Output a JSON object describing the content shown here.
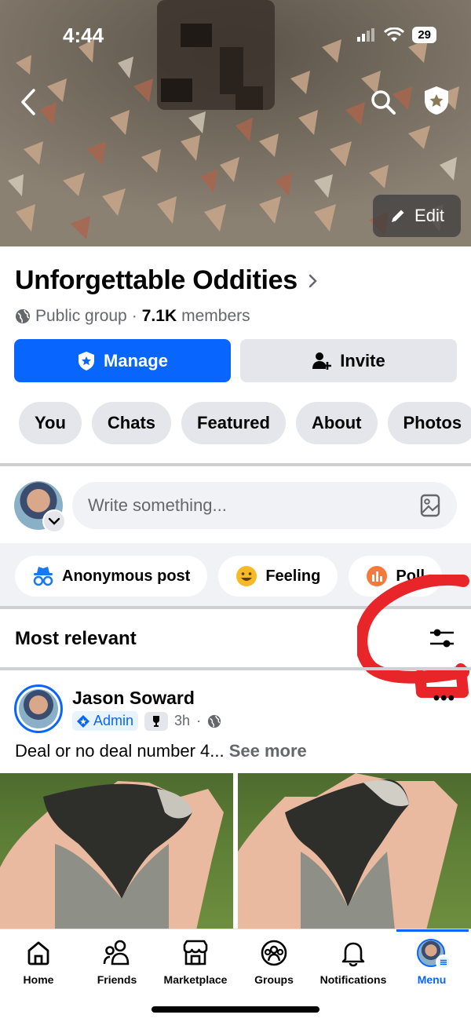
{
  "status": {
    "time": "4:44",
    "battery": "29"
  },
  "cover": {
    "edit_label": "Edit"
  },
  "group": {
    "name": "Unforgettable Oddities",
    "privacy": "Public group",
    "separator": "·",
    "member_count": "7.1K",
    "members_label": "members"
  },
  "actions": {
    "manage": "Manage",
    "invite": "Invite"
  },
  "tabs": [
    "You",
    "Chats",
    "Featured",
    "About",
    "Photos"
  ],
  "composer": {
    "placeholder": "Write something..."
  },
  "quick_actions": [
    "Anonymous post",
    "Feeling",
    "Poll"
  ],
  "feed": {
    "sort_label": "Most relevant"
  },
  "post": {
    "author": "Jason Soward",
    "badge": "Admin",
    "time": "3h",
    "separator": "·",
    "text": "Deal or no deal number 4...",
    "see_more": "See more",
    "more": "•••"
  },
  "bottom_nav": [
    {
      "label": "Home",
      "icon": "home-icon"
    },
    {
      "label": "Friends",
      "icon": "friends-icon"
    },
    {
      "label": "Marketplace",
      "icon": "marketplace-icon"
    },
    {
      "label": "Groups",
      "icon": "groups-icon"
    },
    {
      "label": "Notifications",
      "icon": "bell-icon"
    },
    {
      "label": "Menu",
      "icon": "avatar-menu-icon"
    }
  ],
  "colors": {
    "accent": "#0866ff",
    "chip_bg": "#e4e6eb",
    "muted_text": "#65676b",
    "annotation": "#e8262a"
  }
}
